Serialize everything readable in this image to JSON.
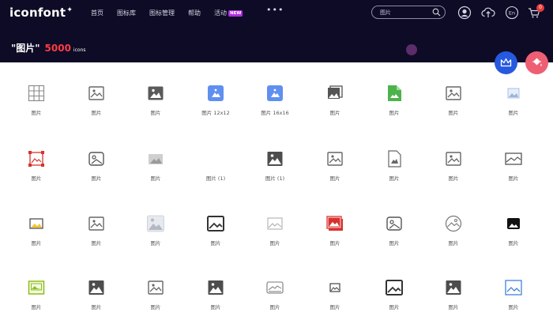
{
  "header": {
    "logo": "iconfont",
    "logo_mark": "✦",
    "nav": [
      {
        "label": "首页"
      },
      {
        "label": "图标库"
      },
      {
        "label": "图标管理"
      },
      {
        "label": "帮助"
      },
      {
        "label": "活动"
      }
    ],
    "nav_badge": "NEW",
    "more": "•••",
    "search": {
      "placeholder": "图片"
    },
    "cart_count": "0",
    "lang": "En"
  },
  "page": {
    "query": "\"图片\"",
    "count": "5000",
    "count_unit": "icons"
  },
  "colors": {
    "topbar": "#0e0b26",
    "count": "#ff3b43",
    "crown_button": "#2759e0",
    "bucket_button": "#ee5f74"
  },
  "icons": [
    {
      "label": "图片",
      "icon": "grid-icon"
    },
    {
      "label": "图片",
      "icon": "image-outline-icon"
    },
    {
      "label": "图片",
      "icon": "image-filled-icon"
    },
    {
      "label": "图片 12x12",
      "icon": "image-blue-filled-icon"
    },
    {
      "label": "图片 16x16",
      "icon": "image-blue-filled-icon"
    },
    {
      "label": "图片",
      "icon": "images-stack-icon"
    },
    {
      "label": "图片",
      "icon": "image-file-green-icon"
    },
    {
      "label": "图片",
      "icon": "image-outline-icon"
    },
    {
      "label": "图片",
      "icon": "image-light-blue-icon"
    },
    {
      "label": "图片",
      "icon": "image-red-frame-icon"
    },
    {
      "label": "图片",
      "icon": "image-rounded-outline-icon"
    },
    {
      "label": "图片",
      "icon": "image-gray-filled-icon"
    },
    {
      "label": "图片 (1)",
      "icon": "blank-icon"
    },
    {
      "label": "图片 (1)",
      "icon": "image-dark-filled-icon"
    },
    {
      "label": "图片",
      "icon": "image-outline-icon"
    },
    {
      "label": "图片",
      "icon": "image-file-icon"
    },
    {
      "label": "图片",
      "icon": "image-outline-icon"
    },
    {
      "label": "图片",
      "icon": "image-wide-outline-icon"
    },
    {
      "label": "图片",
      "icon": "image-yellow-icon"
    },
    {
      "label": "图片",
      "icon": "image-outline-icon"
    },
    {
      "label": "图片",
      "icon": "image-gray-large-icon"
    },
    {
      "label": "图片",
      "icon": "image-bold-outline-icon"
    },
    {
      "label": "图片",
      "icon": "image-thin-outline-icon"
    },
    {
      "label": "图片",
      "icon": "images-red-stack-icon"
    },
    {
      "label": "图片",
      "icon": "image-rounded-outline-icon"
    },
    {
      "label": "图片",
      "icon": "image-circle-icon"
    },
    {
      "label": "图片",
      "icon": "image-black-filled-icon"
    },
    {
      "label": "图片",
      "icon": "image-green-outline-icon"
    },
    {
      "label": "图片",
      "icon": "image-dark-filled-icon"
    },
    {
      "label": "图片",
      "icon": "image-outline-icon"
    },
    {
      "label": "图片",
      "icon": "image-dark-filled-icon"
    },
    {
      "label": "图片",
      "icon": "image-landscape-outline-icon"
    },
    {
      "label": "图片",
      "icon": "image-small-outline-icon"
    },
    {
      "label": "图片",
      "icon": "image-bold-outline-icon"
    },
    {
      "label": "图片",
      "icon": "image-dark-filled-icon"
    },
    {
      "label": "图片",
      "icon": "image-blue-outline-icon"
    }
  ]
}
